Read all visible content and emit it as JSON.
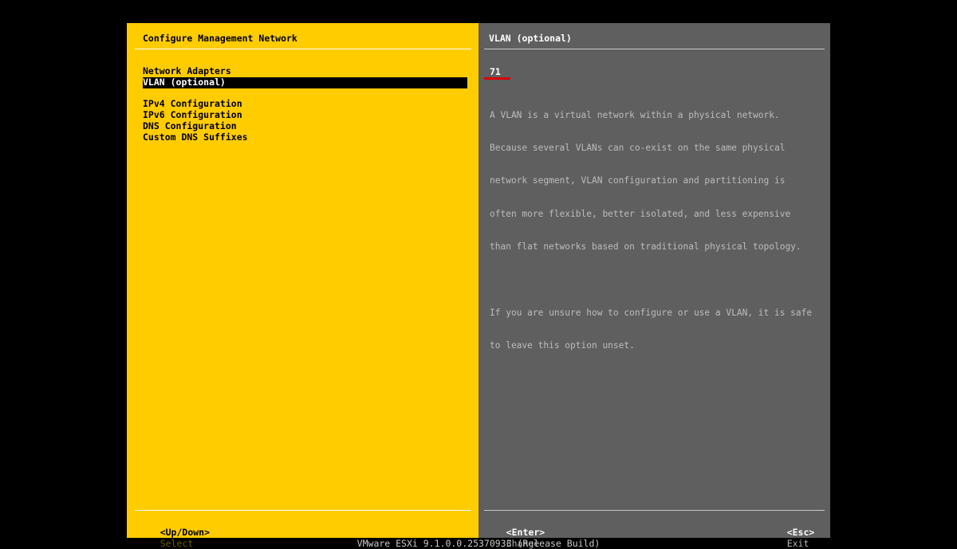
{
  "left_panel": {
    "title": "Configure Management Network",
    "menu_items": [
      {
        "label": "Network Adapters"
      },
      {
        "label": "VLAN (optional)"
      },
      {
        "label": "IPv4 Configuration"
      },
      {
        "label": "IPv6 Configuration"
      },
      {
        "label": "DNS Configuration"
      },
      {
        "label": "Custom DNS Suffixes"
      }
    ],
    "selected_item": "VLAN (optional)"
  },
  "right_panel": {
    "title": "VLAN (optional)",
    "vlan_value": "71",
    "description_lines": [
      "A VLAN is a virtual network within a physical network.",
      "Because several VLANs can co-exist on the same physical",
      "network segment, VLAN configuration and partitioning is",
      "often more flexible, better isolated, and less expensive",
      "than flat networks based on traditional physical topology.",
      "",
      "If you are unsure how to configure or use a VLAN, it is safe",
      "to leave this option unset."
    ]
  },
  "footer": {
    "left_key": "<Up/Down>",
    "left_action": "Select",
    "mid_key": "<Enter>",
    "mid_action": "Change",
    "right_key": "<Esc>",
    "right_action": "Exit"
  },
  "version": "VMware ESXi 9.1.0.0.25370933 (Release Build)",
  "colors": {
    "left_panel_bg": "#ffcc00",
    "right_panel_bg": "#5f5f5f",
    "selection_bg": "#000000",
    "underline_accent": "#d80000"
  }
}
